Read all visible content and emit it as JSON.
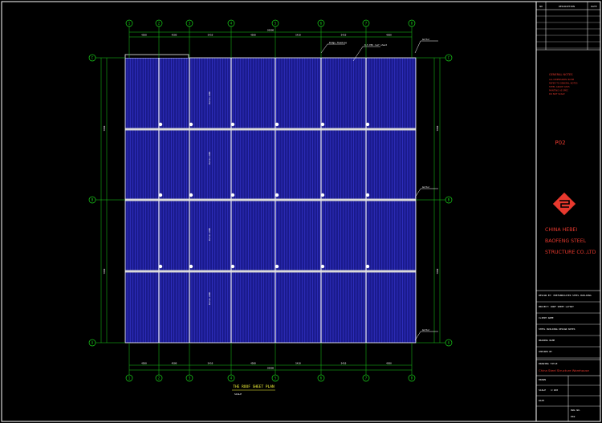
{
  "drawing": {
    "title": "THE ROOF SHEET PLAN",
    "scale": "SCALE",
    "grid_columns": [
      "1",
      "2",
      "3",
      "4",
      "5",
      "6",
      "7",
      "8"
    ],
    "grid_rows": [
      "C",
      "B",
      "A"
    ],
    "dimension_top": [
      "4500",
      "4500",
      "5410",
      "4500",
      "5410",
      "5410",
      "4500"
    ],
    "dimension_total": "30000",
    "dimension_bottom": [
      "4500",
      "4500",
      "5410",
      "4500",
      "5410",
      "5410",
      "4500"
    ],
    "dimension_left": [
      "7000",
      "7000"
    ],
    "dimension_right": [
      "7000",
      "7000"
    ],
    "leader_notes": [
      "Ridge flashing",
      "0.5 EPS roof sheet",
      "Gutter",
      "Gutter",
      "Gutter"
    ],
    "purlin_tag": "Purlin Z200"
  },
  "title_block": {
    "revision_headers": [
      "NO",
      "DESCRIPTION",
      "DATE"
    ],
    "notes_heading": "GENERAL NOTES",
    "notes_lines": [
      "ALL DIMENSIONS IN MM",
      "REFER TO GENERAL NOTES",
      "STEEL GRADE Q345",
      "PAINTING AS SPEC",
      "DO NOT SCALE"
    ],
    "sheet_code": "P02",
    "company_lines": [
      "CHINA HEBEI",
      "BAOFENG STEEL",
      "STRUCTURE CO.,LTD"
    ],
    "fields": [
      "DESIGN BY: PREFABRICATED STEEL BUILDING",
      "PROJECT: ROOF SHEET LAYOUT",
      "CLIENT NAME",
      "STEEL BUILDING DESIGN NOTES",
      "DRAWING NAME",
      "CHECKED BY"
    ],
    "drawing_title_label": "DRAWING TITLE",
    "drawing_title": "China Steel Structure Warehouse",
    "drawn": "DRAWN",
    "scale_label": "SCALE",
    "scale_value": "1:100",
    "date_label": "DATE",
    "drawing_no_label": "DWG NO.",
    "drawing_no": "P02"
  },
  "colors": {
    "sheet": "#1a1a8c",
    "sheet_line": "#3a3ad8",
    "grid": "#19d219",
    "frame": "#ffffff",
    "accent": "#e8392e"
  }
}
